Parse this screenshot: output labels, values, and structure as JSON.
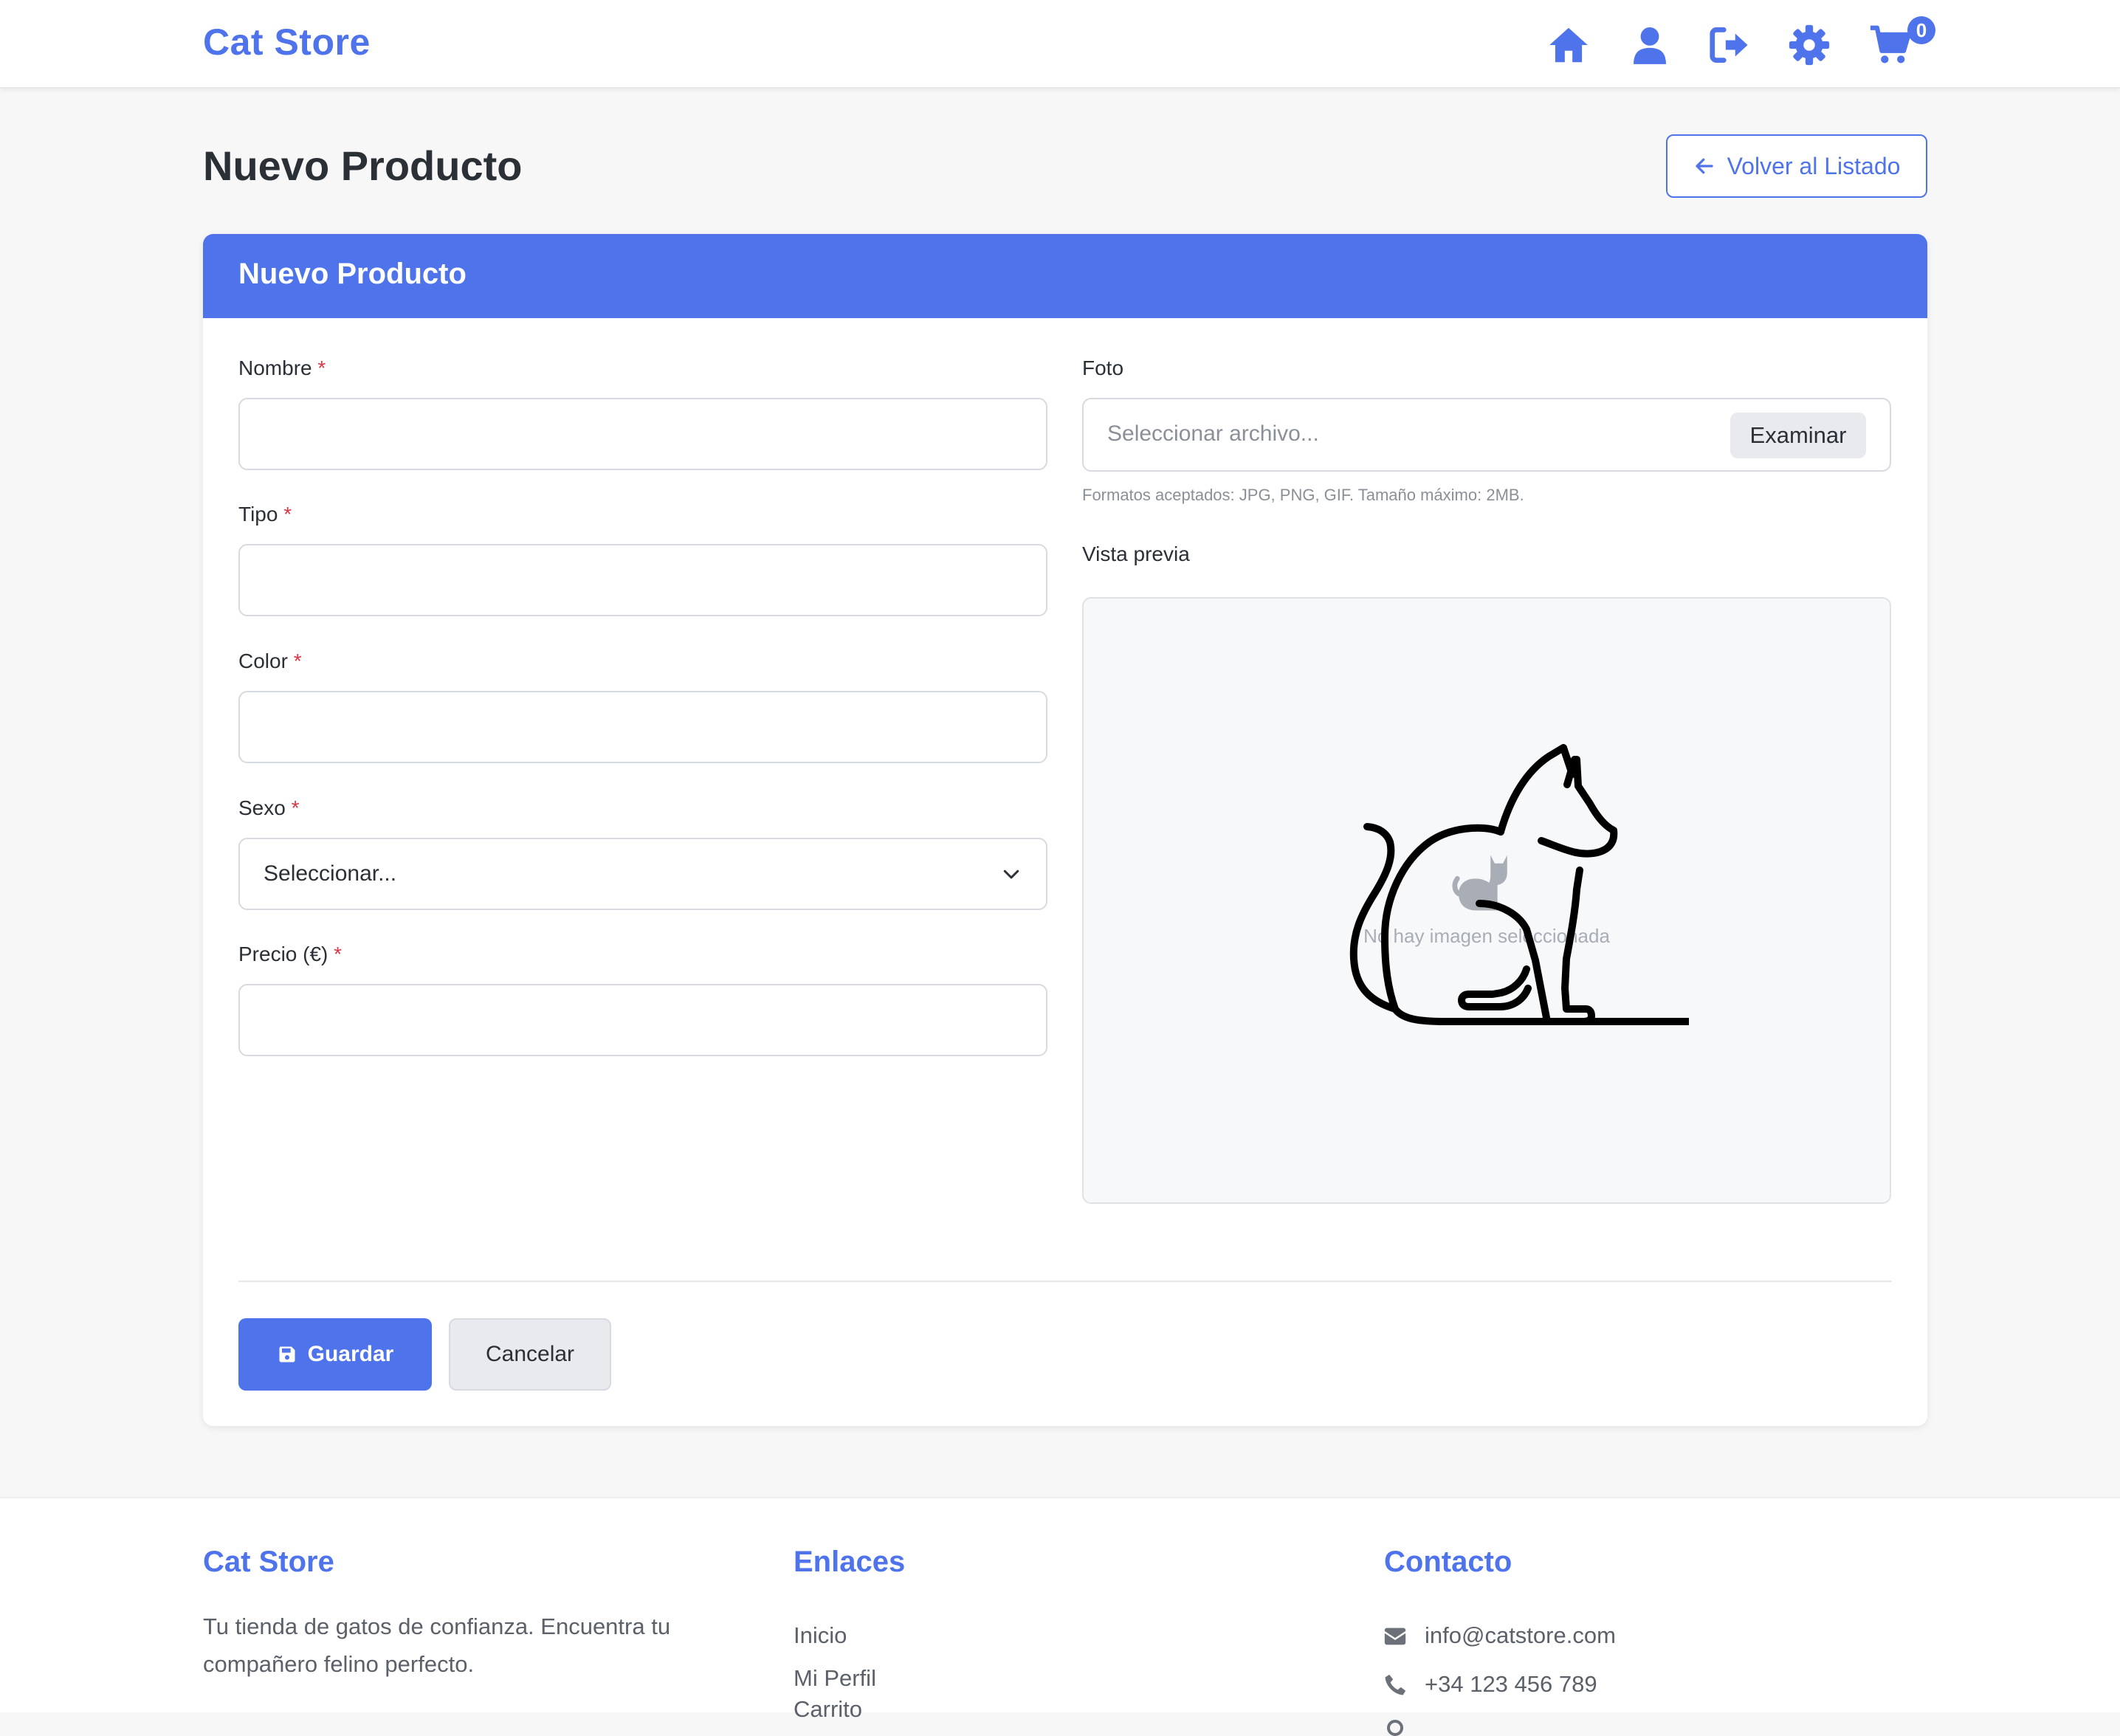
{
  "navbar": {
    "brand": "Cat Store",
    "icons": [
      "home-icon",
      "user-icon",
      "logout-icon",
      "gear-icon",
      "cart-icon"
    ],
    "cart_count": "0"
  },
  "header": {
    "title": "Nuevo Producto",
    "back_button": "Volver al Listado"
  },
  "form": {
    "card_title": "Nuevo Producto",
    "required_mark": "*",
    "fields": {
      "nombre": {
        "label": "Nombre",
        "value": ""
      },
      "tipo": {
        "label": "Tipo",
        "value": ""
      },
      "color": {
        "label": "Color",
        "value": ""
      },
      "sexo": {
        "label": "Sexo",
        "selected": "Seleccionar..."
      },
      "precio": {
        "label": "Precio (€)",
        "value": ""
      }
    },
    "foto": {
      "label": "Foto",
      "placeholder": "Seleccionar archivo...",
      "browse_button": "Examinar",
      "help": "Formatos aceptados: JPG, PNG, GIF. Tamaño máximo: 2MB."
    },
    "preview": {
      "label": "Vista previa",
      "empty_text": "No hay imagen seleccionada"
    },
    "buttons": {
      "save": "Guardar",
      "cancel": "Cancelar"
    }
  },
  "footer": {
    "about": {
      "title": "Cat Store",
      "text_line1": "Tu tienda de gatos de confianza. Encuentra tu",
      "text_line2": "compañero felino perfecto."
    },
    "links": {
      "title": "Enlaces",
      "items": [
        "Inicio",
        "Mi Perfil",
        "Carrito"
      ]
    },
    "contact": {
      "title": "Contacto",
      "email": "info@catstore.com",
      "phone": "+34 123 456 789"
    }
  },
  "colors": {
    "primary": "#4e73ea",
    "required": "#dc3545",
    "background": "#f7f7f8"
  }
}
